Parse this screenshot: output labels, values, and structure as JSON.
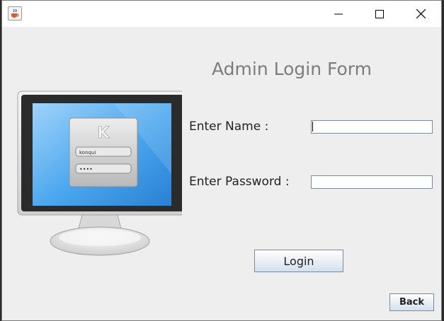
{
  "window": {
    "app_icon": "java-cup-icon",
    "controls": {
      "minimize": "minimize-icon",
      "maximize": "maximize-icon",
      "close": "close-icon"
    }
  },
  "form": {
    "title": "Admin Login Form",
    "name_label": "Enter Name :",
    "name_value": "",
    "password_label": "Enter Password :",
    "password_value": "",
    "login_button": "Login",
    "back_button": "Back"
  },
  "illustration": {
    "logo_letter": "K",
    "username": "konqui",
    "password_mask": "••••"
  },
  "colors": {
    "window_bg": "#eeeeee",
    "title_text": "#7d7d7d",
    "screen_blue": "#3f9de8"
  }
}
